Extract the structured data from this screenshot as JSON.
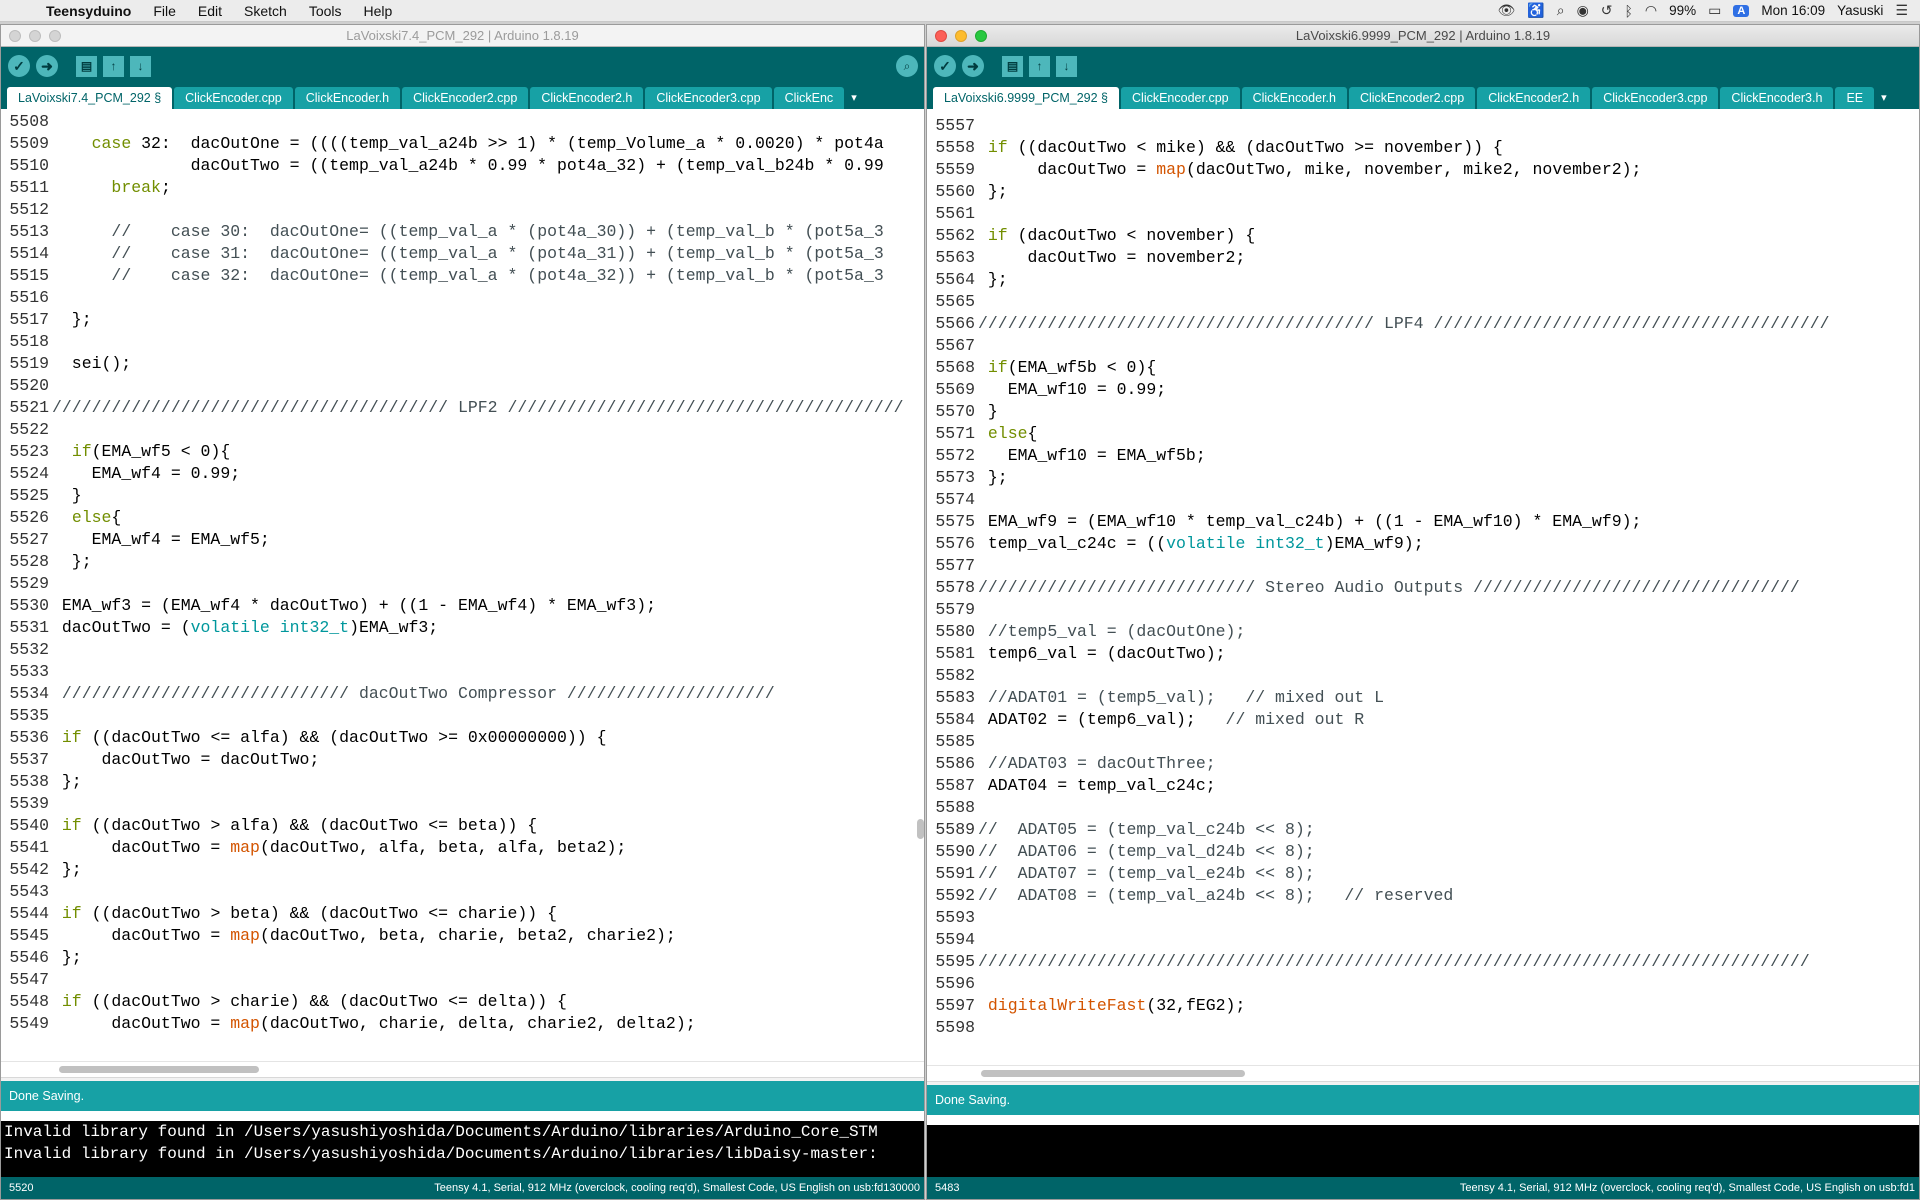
{
  "menubar": {
    "app_name": "Teensyduino",
    "items": [
      "File",
      "Edit",
      "Sketch",
      "Tools",
      "Help"
    ],
    "battery": "99%",
    "input_source": "A",
    "clock": "Mon 16:09",
    "user": "Yasuski"
  },
  "left": {
    "title": "LaVoixski7.4_PCM_292 | Arduino 1.8.19",
    "tabs": [
      "LaVoixski7.4_PCM_292 §",
      "ClickEncoder.cpp",
      "ClickEncoder.h",
      "ClickEncoder2.cpp",
      "ClickEncoder2.h",
      "ClickEncoder3.cpp",
      "ClickEnc"
    ],
    "lines": [
      {
        "n": "5508",
        "t": ""
      },
      {
        "n": "5509",
        "t": "    case 32:  dacOutOne = ((((temp_val_a24b >> 1) * (temp_Volume_a * 0.0020) * pot4a"
      },
      {
        "n": "5510",
        "t": "              dacOutTwo = ((temp_val_a24b * 0.99 * pot4a_32) + (temp_val_b24b * 0.99"
      },
      {
        "n": "5511",
        "t": "      break;"
      },
      {
        "n": "5512",
        "t": ""
      },
      {
        "n": "5513",
        "t": "      //    case 30:  dacOutOne= ((temp_val_a * (pot4a_30)) + (temp_val_b * (pot5a_3"
      },
      {
        "n": "5514",
        "t": "      //    case 31:  dacOutOne= ((temp_val_a * (pot4a_31)) + (temp_val_b * (pot5a_3"
      },
      {
        "n": "5515",
        "t": "      //    case 32:  dacOutOne= ((temp_val_a * (pot4a_32)) + (temp_val_b * (pot5a_3"
      },
      {
        "n": "5516",
        "t": ""
      },
      {
        "n": "5517",
        "t": "  };"
      },
      {
        "n": "5518",
        "t": ""
      },
      {
        "n": "5519",
        "t": "  sei();"
      },
      {
        "n": "5520",
        "t": ""
      },
      {
        "n": "5521",
        "t": "//////////////////////////////////////// LPF2 ////////////////////////////////////////"
      },
      {
        "n": "5522",
        "t": ""
      },
      {
        "n": "5523",
        "t": "  if(EMA_wf5 < 0){"
      },
      {
        "n": "5524",
        "t": "    EMA_wf4 = 0.99;"
      },
      {
        "n": "5525",
        "t": "  }"
      },
      {
        "n": "5526",
        "t": "  else{"
      },
      {
        "n": "5527",
        "t": "    EMA_wf4 = EMA_wf5;"
      },
      {
        "n": "5528",
        "t": "  };"
      },
      {
        "n": "5529",
        "t": ""
      },
      {
        "n": "5530",
        "t": " EMA_wf3 = (EMA_wf4 * dacOutTwo) + ((1 - EMA_wf4) * EMA_wf3);"
      },
      {
        "n": "5531",
        "t": " dacOutTwo = (volatile int32_t)EMA_wf3;"
      },
      {
        "n": "5532",
        "t": ""
      },
      {
        "n": "5533",
        "t": ""
      },
      {
        "n": "5534",
        "t": " ///////////////////////////// dacOutTwo Compressor /////////////////////"
      },
      {
        "n": "5535",
        "t": ""
      },
      {
        "n": "5536",
        "t": " if ((dacOutTwo <= alfa) && (dacOutTwo >= 0x00000000)) {"
      },
      {
        "n": "5537",
        "t": "     dacOutTwo = dacOutTwo;"
      },
      {
        "n": "5538",
        "t": " };"
      },
      {
        "n": "5539",
        "t": ""
      },
      {
        "n": "5540",
        "t": " if ((dacOutTwo > alfa) && (dacOutTwo <= beta)) {"
      },
      {
        "n": "5541",
        "t": "      dacOutTwo = map(dacOutTwo, alfa, beta, alfa, beta2);"
      },
      {
        "n": "5542",
        "t": " };"
      },
      {
        "n": "5543",
        "t": ""
      },
      {
        "n": "5544",
        "t": " if ((dacOutTwo > beta) && (dacOutTwo <= charie)) {"
      },
      {
        "n": "5545",
        "t": "      dacOutTwo = map(dacOutTwo, beta, charie, beta2, charie2);"
      },
      {
        "n": "5546",
        "t": " };"
      },
      {
        "n": "5547",
        "t": ""
      },
      {
        "n": "5548",
        "t": " if ((dacOutTwo > charie) && (dacOutTwo <= delta)) {"
      },
      {
        "n": "5549",
        "t": "      dacOutTwo = map(dacOutTwo, charie, delta, charie2, delta2);"
      }
    ],
    "status": "Done Saving.",
    "console": [
      "Invalid library found in /Users/yasushiyoshida/Documents/Arduino/libraries/Arduino_Core_STM",
      "Invalid library found in /Users/yasushiyoshida/Documents/Arduino/libraries/libDaisy-master:"
    ],
    "footer_line": "5520",
    "footer_board": "Teensy 4.1, Serial, 912 MHz (overclock, cooling req'd), Smallest Code, US English on usb:fd130000"
  },
  "right": {
    "title": "LaVoixski6.9999_PCM_292 | Arduino 1.8.19",
    "tabs": [
      "LaVoixski6.9999_PCM_292 §",
      "ClickEncoder.cpp",
      "ClickEncoder.h",
      "ClickEncoder2.cpp",
      "ClickEncoder2.h",
      "ClickEncoder3.cpp",
      "ClickEncoder3.h",
      "EE"
    ],
    "lines": [
      {
        "n": "5557",
        "t": ""
      },
      {
        "n": "5558",
        "t": " if ((dacOutTwo < mike) && (dacOutTwo >= november)) {"
      },
      {
        "n": "5559",
        "t": "      dacOutTwo = map(dacOutTwo, mike, november, mike2, november2);"
      },
      {
        "n": "5560",
        "t": " };"
      },
      {
        "n": "5561",
        "t": ""
      },
      {
        "n": "5562",
        "t": " if (dacOutTwo < november) {"
      },
      {
        "n": "5563",
        "t": "     dacOutTwo = november2;"
      },
      {
        "n": "5564",
        "t": " };"
      },
      {
        "n": "5565",
        "t": ""
      },
      {
        "n": "5566",
        "t": "//////////////////////////////////////// LPF4 ////////////////////////////////////////"
      },
      {
        "n": "5567",
        "t": ""
      },
      {
        "n": "5568",
        "t": " if(EMA_wf5b < 0){"
      },
      {
        "n": "5569",
        "t": "   EMA_wf10 = 0.99;"
      },
      {
        "n": "5570",
        "t": " }"
      },
      {
        "n": "5571",
        "t": " else{"
      },
      {
        "n": "5572",
        "t": "   EMA_wf10 = EMA_wf5b;"
      },
      {
        "n": "5573",
        "t": " };"
      },
      {
        "n": "5574",
        "t": ""
      },
      {
        "n": "5575",
        "t": " EMA_wf9 = (EMA_wf10 * temp_val_c24b) + ((1 - EMA_wf10) * EMA_wf9);"
      },
      {
        "n": "5576",
        "t": " temp_val_c24c = ((volatile int32_t)EMA_wf9);"
      },
      {
        "n": "5577",
        "t": ""
      },
      {
        "n": "5578",
        "t": "//////////////////////////// Stereo Audio Outputs /////////////////////////////////"
      },
      {
        "n": "5579",
        "t": ""
      },
      {
        "n": "5580",
        "t": " //temp5_val = (dacOutOne);"
      },
      {
        "n": "5581",
        "t": " temp6_val = (dacOutTwo);"
      },
      {
        "n": "5582",
        "t": ""
      },
      {
        "n": "5583",
        "t": " //ADAT01 = (temp5_val);   // mixed out L"
      },
      {
        "n": "5584",
        "t": " ADAT02 = (temp6_val);   // mixed out R"
      },
      {
        "n": "5585",
        "t": ""
      },
      {
        "n": "5586",
        "t": " //ADAT03 = dacOutThree;"
      },
      {
        "n": "5587",
        "t": " ADAT04 = temp_val_c24c;"
      },
      {
        "n": "5588",
        "t": ""
      },
      {
        "n": "5589",
        "t": "//  ADAT05 = (temp_val_c24b << 8);"
      },
      {
        "n": "5590",
        "t": "//  ADAT06 = (temp_val_d24b << 8);"
      },
      {
        "n": "5591",
        "t": "//  ADAT07 = (temp_val_e24b << 8);"
      },
      {
        "n": "5592",
        "t": "//  ADAT08 = (temp_val_a24b << 8);   // reserved"
      },
      {
        "n": "5593",
        "t": ""
      },
      {
        "n": "5594",
        "t": ""
      },
      {
        "n": "5595",
        "t": "////////////////////////////////////////////////////////////////////////////////////"
      },
      {
        "n": "5596",
        "t": ""
      },
      {
        "n": "5597",
        "t": " digitalWriteFast(32,fEG2);"
      },
      {
        "n": "5598",
        "t": ""
      }
    ],
    "status": "Done Saving.",
    "console": [],
    "footer_line": "5483",
    "footer_board": "Teensy 4.1, Serial, 912 MHz (overclock, cooling req'd), Smallest Code, US English on usb:fd1"
  }
}
